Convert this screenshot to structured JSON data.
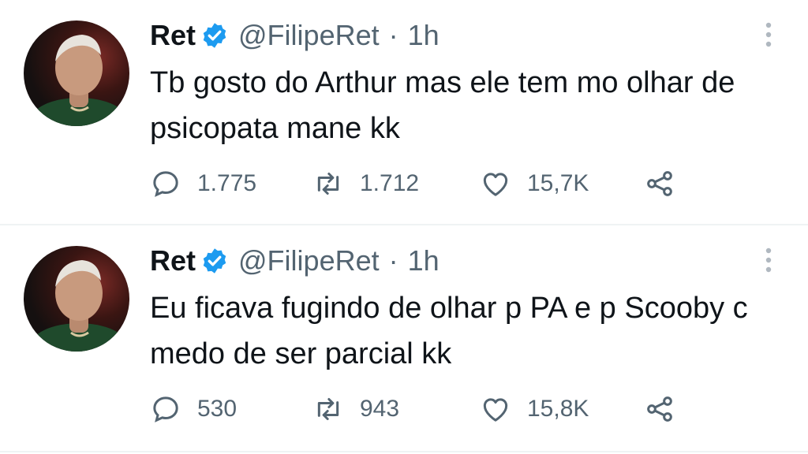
{
  "colors": {
    "text": "#0f1419",
    "secondary": "#536471",
    "verified": "#1d9bf0",
    "divider": "#eff3f4"
  },
  "tweets": [
    {
      "name": "Ret",
      "handle": "@FilipeRet",
      "separator": "·",
      "time": "1h",
      "text": "Tb gosto do Arthur mas ele tem mo olhar de psicopata mane kk",
      "replies": "1.775",
      "retweets": "1.712",
      "likes": "15,7K"
    },
    {
      "name": "Ret",
      "handle": "@FilipeRet",
      "separator": "·",
      "time": "1h",
      "text": "Eu ficava fugindo de olhar p PA e p Scooby c medo de ser parcial kk",
      "replies": "530",
      "retweets": "943",
      "likes": "15,8K"
    }
  ],
  "icons": {
    "verified": "verified-badge-icon",
    "more": "more-vertical-icon",
    "reply": "reply-bubble-icon",
    "retweet": "retweet-arrows-icon",
    "like": "heart-icon",
    "share": "share-nodes-icon"
  }
}
